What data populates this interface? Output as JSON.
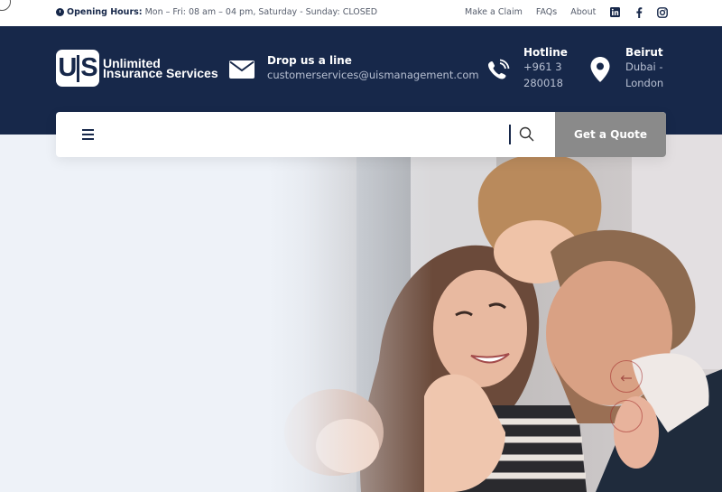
{
  "topbar": {
    "hours_label": "Opening Hours:",
    "hours_value": "Mon – Fri: 08 am – 04 pm, Saturday - Sunday: CLOSED",
    "links": [
      "Make a Claim",
      "FAQs",
      "About"
    ],
    "social_icons": [
      "linkedin-icon",
      "facebook-icon",
      "instagram-icon"
    ]
  },
  "header": {
    "logo_mark": "U S",
    "logo_line1": "Unlimited",
    "logo_line2": "Insurance Services",
    "email": {
      "title": "Drop us a line",
      "value": "customerservices@uismanagement.com"
    },
    "hotline": {
      "title": "Hotline",
      "line1": "+961 3",
      "line2": "280018"
    },
    "location": {
      "title": "Beirut",
      "line1": "Dubai -",
      "line2": "London"
    }
  },
  "searchbar": {
    "quote_label": "Get a Quote"
  },
  "colors": {
    "navy": "#17284a",
    "quote_bg": "#8a8a8a",
    "hero_fade": "#eef2f8"
  }
}
